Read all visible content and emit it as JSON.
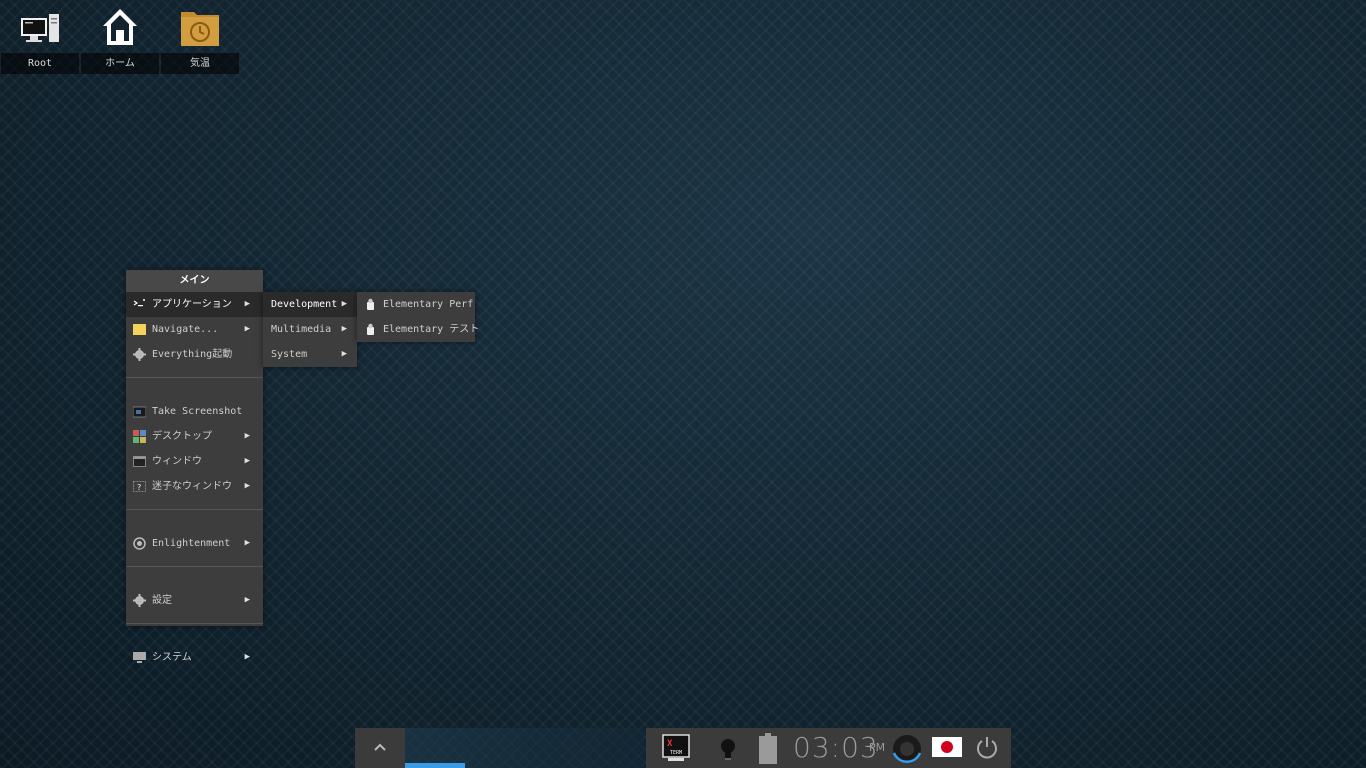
{
  "desktop": {
    "icons": [
      {
        "label": "Root",
        "icon": "computer-icon"
      },
      {
        "label": "ホーム",
        "icon": "home-icon"
      },
      {
        "label": "気温",
        "icon": "folder-clock-icon"
      }
    ]
  },
  "main_menu": {
    "title": "メイン",
    "items": [
      {
        "label": "アプリケーション",
        "icon": "applications-icon",
        "submenu": true
      },
      {
        "label": "Navigate...",
        "icon": "folder-icon",
        "submenu": true
      },
      {
        "label": "Everything起動",
        "icon": "gear-icon",
        "submenu": false
      },
      {
        "label": "Take Screenshot",
        "icon": "screenshot-icon",
        "submenu": false
      },
      {
        "label": "デスクトップ",
        "icon": "desktop-icon",
        "submenu": true
      },
      {
        "label": "ウィンドウ",
        "icon": "window-icon",
        "submenu": true
      },
      {
        "label": "迷子なウィンドウ",
        "icon": "lost-window-icon",
        "submenu": true
      },
      {
        "label": "Enlightenment",
        "icon": "enlightenment-icon",
        "submenu": true
      },
      {
        "label": "設定",
        "icon": "settings-icon",
        "submenu": true
      },
      {
        "label": "システム",
        "icon": "system-icon",
        "submenu": true
      }
    ]
  },
  "apps_menu": {
    "items": [
      {
        "label": "Development"
      },
      {
        "label": "Multimedia"
      },
      {
        "label": "System"
      }
    ]
  },
  "dev_menu": {
    "items": [
      {
        "label": "Elementary Perf",
        "icon": "elementary-icon"
      },
      {
        "label": "Elementary テスト",
        "icon": "elementary-icon"
      }
    ]
  },
  "shelf": {
    "clock": {
      "time": "03:03",
      "ampm": "PM"
    },
    "gadgets": [
      "xterm-icon",
      "lightbulb-icon",
      "battery-icon",
      "mixer-icon",
      "japan-flag-icon",
      "power-icon"
    ],
    "accent": "#3a9be6"
  }
}
